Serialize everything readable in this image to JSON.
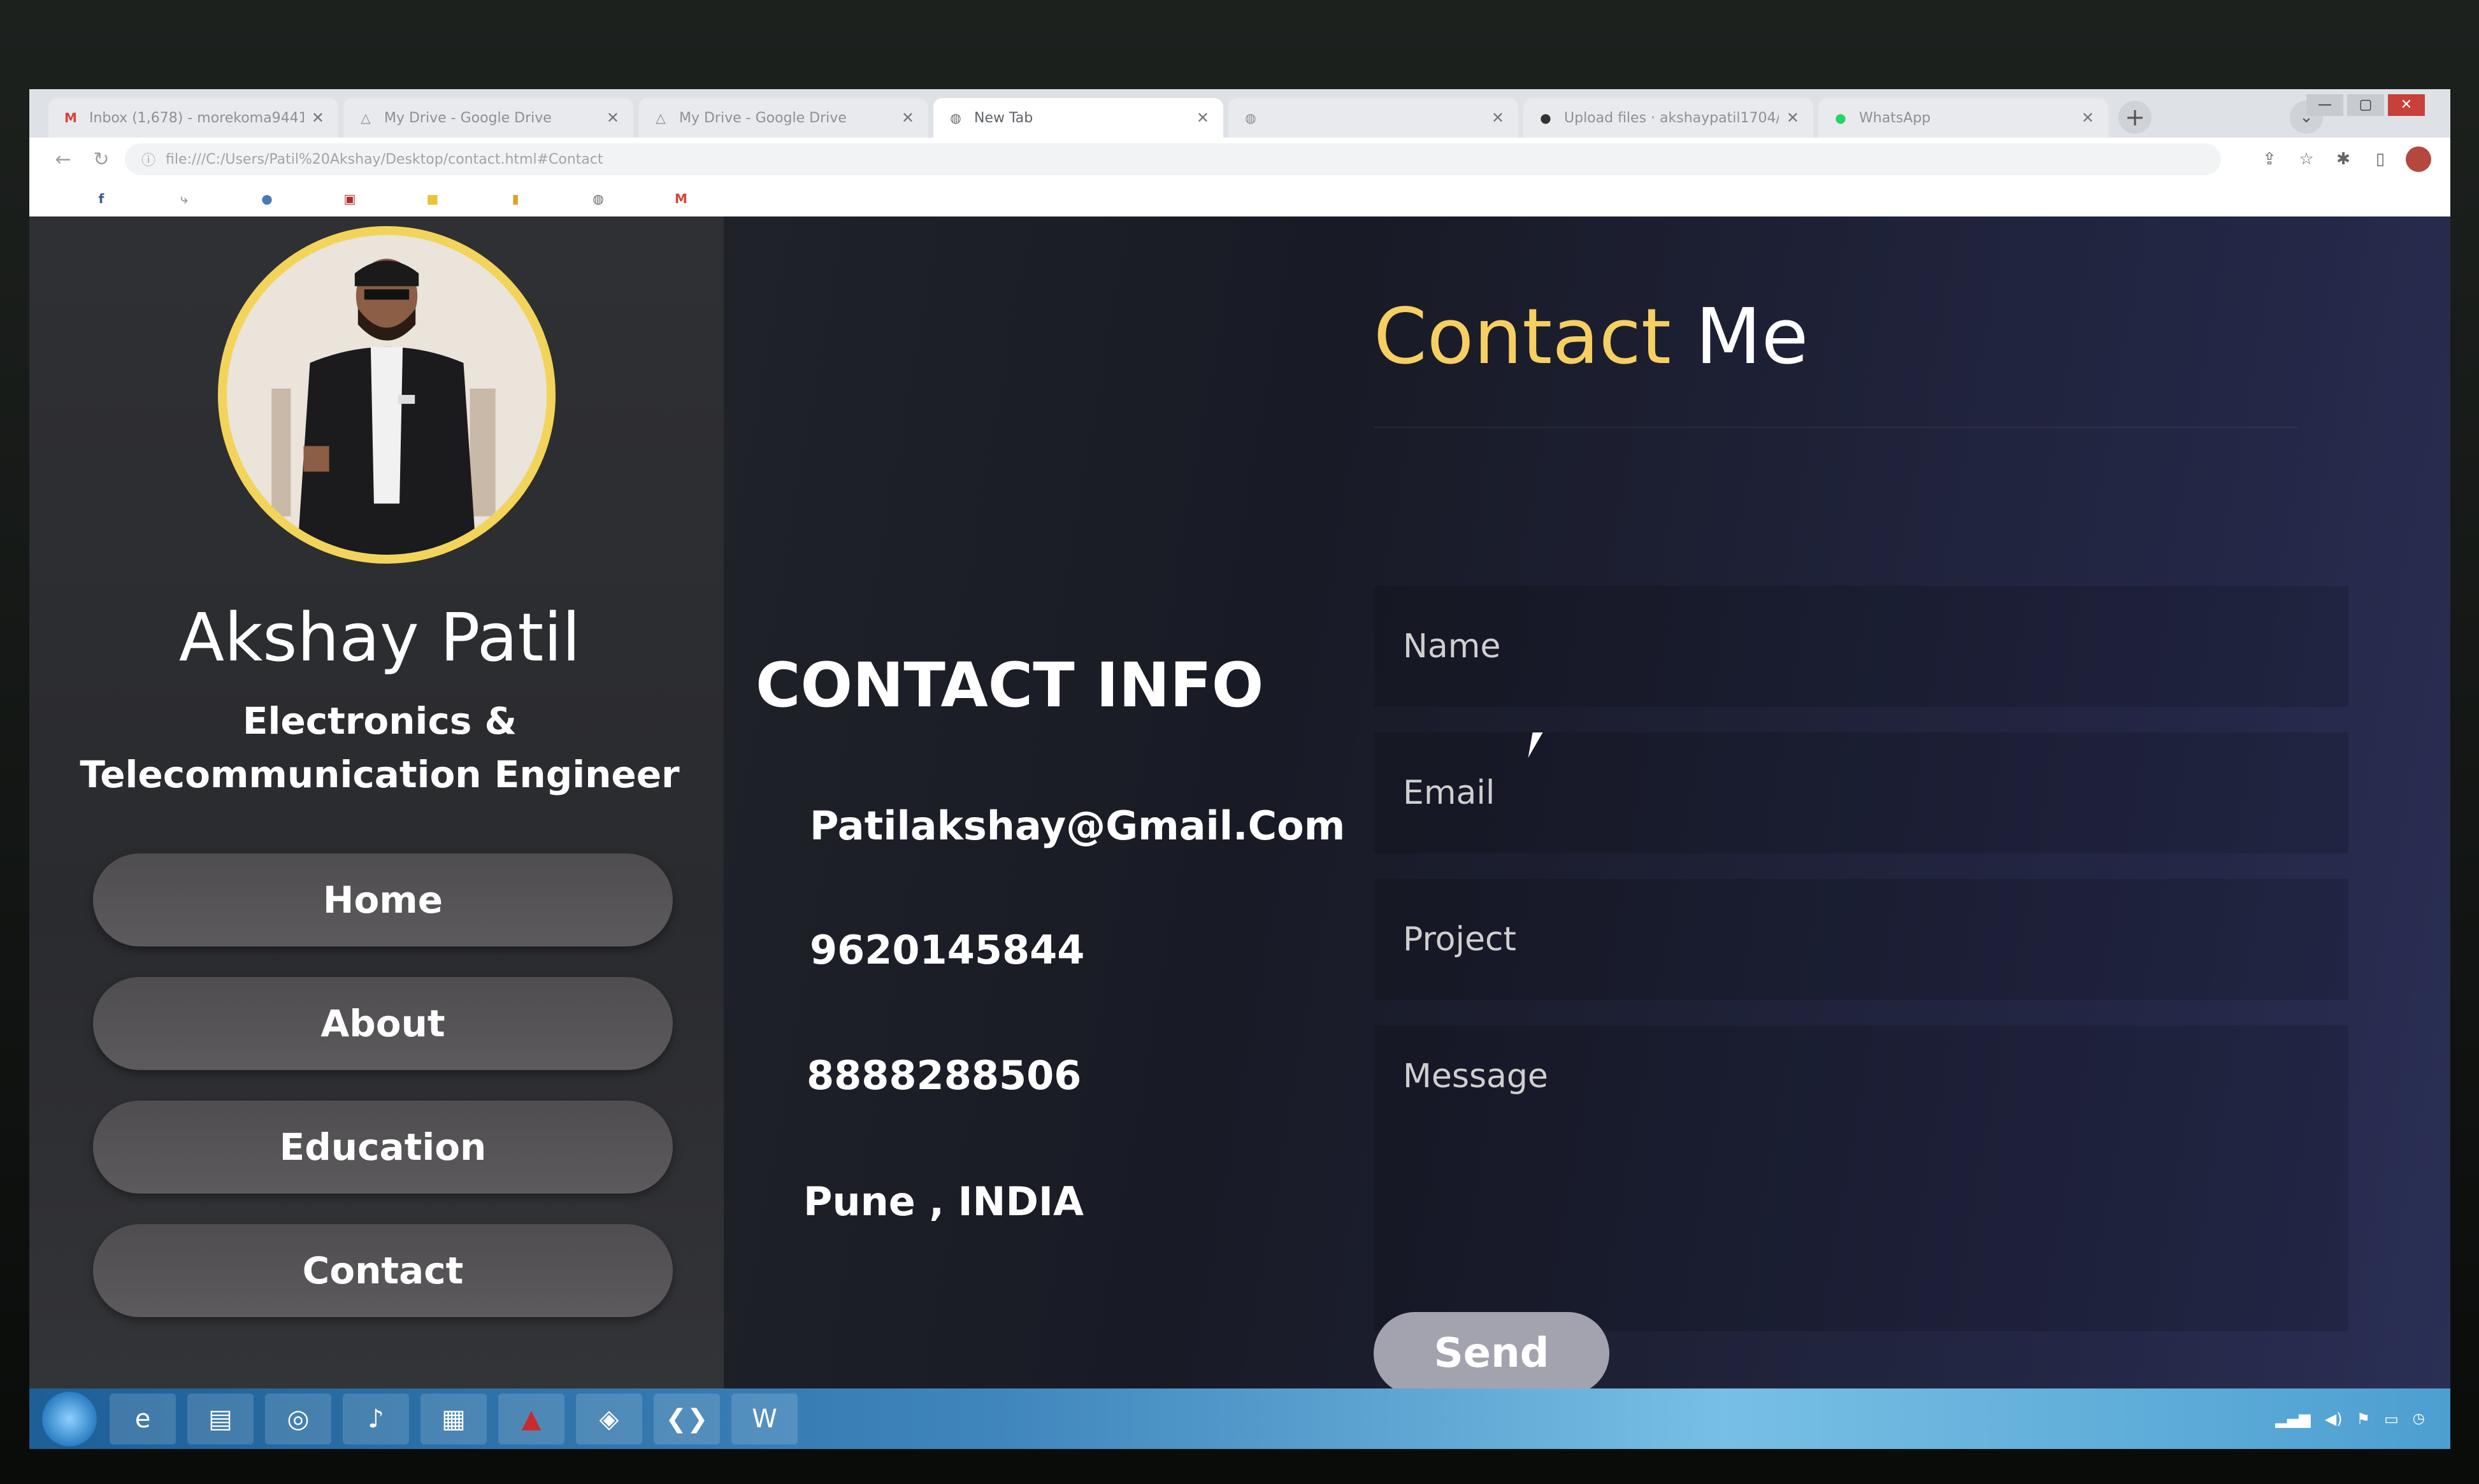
{
  "browser": {
    "tabs": [
      {
        "title": "Inbox (1,678) - morekoma9441@",
        "icon": "gmail-icon",
        "active": false
      },
      {
        "title": "My Drive - Google Drive",
        "icon": "drive-icon",
        "active": false
      },
      {
        "title": "My Drive - Google Drive",
        "icon": "drive-icon",
        "active": false
      },
      {
        "title": "New Tab",
        "icon": "globe-icon",
        "active": true
      },
      {
        "title": "",
        "icon": "globe-icon",
        "active": false
      },
      {
        "title": "Upload files · akshaypatil1704/...",
        "icon": "github-icon",
        "active": false
      },
      {
        "title": "WhatsApp",
        "icon": "whatsapp-icon",
        "active": false
      }
    ],
    "new_tab_symbol": "+",
    "url": "file:///C:/Users/Patil%20Akshay/Desktop/contact.html#Contact"
  },
  "sidebar": {
    "name": "Akshay Patil",
    "role": "Electronics & Telecommunication Engineer",
    "nav": [
      {
        "label": "Home"
      },
      {
        "label": "About"
      },
      {
        "label": "Education"
      },
      {
        "label": "Contact"
      }
    ]
  },
  "contact_info": {
    "title": "CONTACT INFO",
    "email": "Patilakshay@Gmail.Com",
    "phone1": "9620145844",
    "phone2": "8888288506",
    "location": "Pune , INDIA"
  },
  "contact_form": {
    "title_highlight": "Contact",
    "title_rest": "Me",
    "name_placeholder": "Name",
    "email_placeholder": "Email",
    "project_placeholder": "Project",
    "message_placeholder": "Message",
    "send_label": "Send"
  },
  "colors": {
    "accent_yellow": "#f6cf62",
    "nav_button": "#565456",
    "send_button": "#a3a3b0"
  }
}
